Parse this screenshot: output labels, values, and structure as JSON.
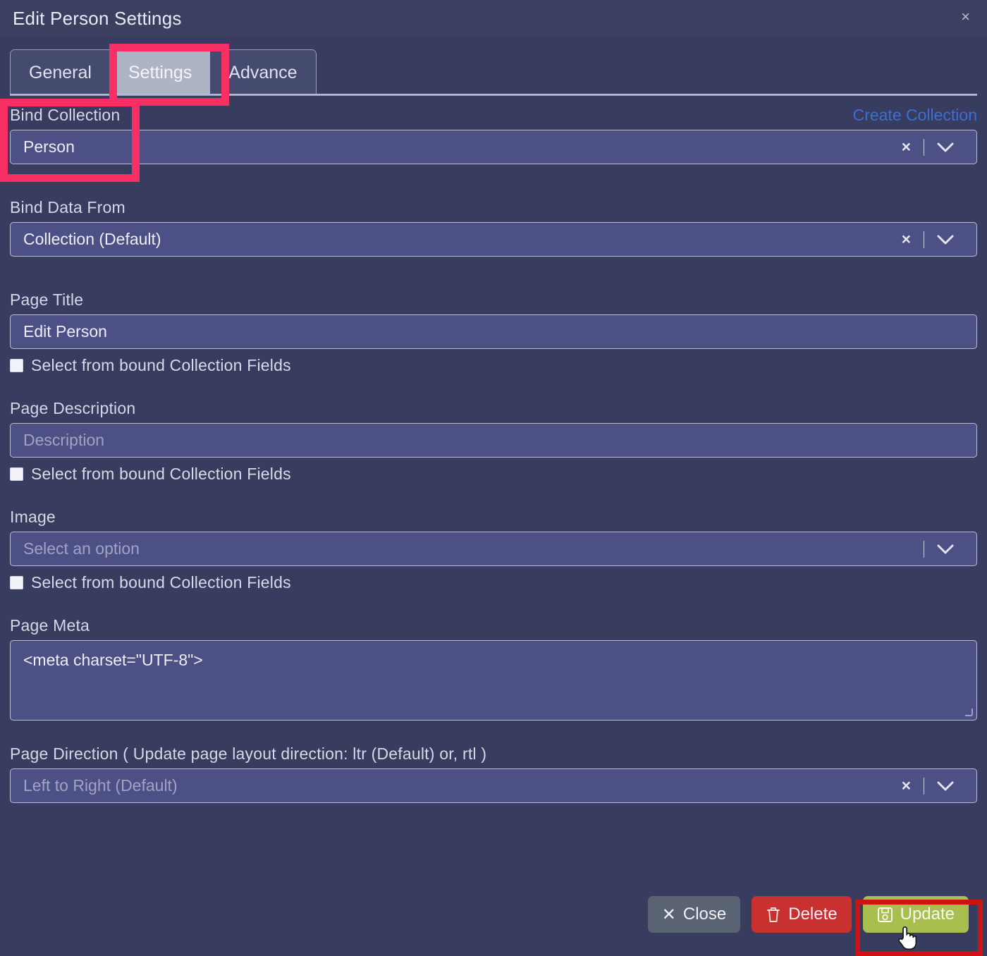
{
  "window": {
    "title": "Edit Person Settings",
    "close_icon": "close-icon",
    "close_glyph": "×"
  },
  "tabs": [
    {
      "label": "General",
      "active": false
    },
    {
      "label": "Settings",
      "active": true
    },
    {
      "label": "Advance",
      "active": false
    }
  ],
  "fields": {
    "bind_collection": {
      "label": "Bind Collection",
      "action_link": "Create Collection",
      "value": "Person",
      "clear_glyph": "×",
      "has_clear": true,
      "has_caret": true
    },
    "bind_data_from": {
      "label": "Bind Data From",
      "value": "Collection (Default)",
      "clear_glyph": "×",
      "has_clear": true,
      "has_caret": true
    },
    "page_title": {
      "label": "Page Title",
      "value": "Edit Person",
      "checkbox_label": "Select from bound Collection Fields",
      "checked": false
    },
    "page_description": {
      "label": "Page Description",
      "placeholder": "Description",
      "value": "",
      "checkbox_label": "Select from bound Collection Fields",
      "checked": false
    },
    "image": {
      "label": "Image",
      "placeholder": "Select an option",
      "value": "",
      "has_clear": false,
      "has_caret": true,
      "checkbox_label": "Select from bound Collection Fields",
      "checked": false
    },
    "page_meta": {
      "label": "Page Meta",
      "value": "<meta charset=\"UTF-8\">"
    },
    "page_direction": {
      "label": "Page Direction ( Update page layout direction: ltr (Default) or, rtl )",
      "value": "Left to Right (Default)",
      "clear_glyph": "×",
      "has_clear": true,
      "has_caret": true
    }
  },
  "footer": {
    "close_label": "Close",
    "close_icon": "close-x-icon",
    "close_glyph": "✕",
    "delete_label": "Delete",
    "delete_icon": "trash-icon",
    "update_label": "Update",
    "update_icon": "save-floppy-icon"
  },
  "colors": {
    "background": "#383c5e",
    "titlebar": "#3b3f60",
    "input_bg": "#4d5084",
    "input_border": "#b9bdd2",
    "tab_active_bg": "#aeb4c4",
    "tab_inactive_bg": "#454a6f",
    "link_blue": "#3b6fd4",
    "btn_close": "#5a6372",
    "btn_delete": "#c93030",
    "btn_update": "#a8bf4f",
    "annotation_pink": "#f72f64",
    "annotation_red": "#cf1212"
  }
}
